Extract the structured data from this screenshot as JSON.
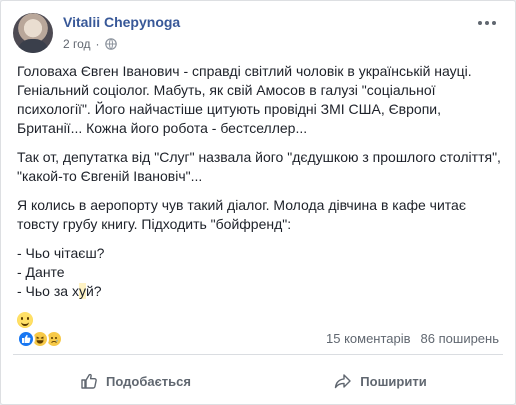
{
  "post": {
    "author": "Vitalii Chepynoga",
    "time": "2 год",
    "separator": "·",
    "paragraphs": {
      "p1": [
        "Головаха Євген Іванович - справді світлий чоловік в українській науці.",
        "Геніальний соціолог. Мабуть, як свій Амосов в галузі \"соціальної",
        "психології\". Його найчастіше цитують провідні ЗМІ США, Європи,",
        "Британії... Кожна його робота - бестселлер..."
      ],
      "p2": [
        "Так от, депутатка від \"Слуг\" назвала його \"дєдушкою з прошлого століття\",",
        "\"какой-то Євгеній Івановіч\"..."
      ],
      "p3": [
        "Я колись в аеропорту чув такий діалог. Молода дівчина в кафе читає",
        "товсту грубу книгу. Підходить \"бойфренд\":"
      ],
      "dialog": {
        "line1": "- Чьо чітаєш?",
        "line2": "- Данте",
        "line3_start": "- Чьо за х",
        "line3_hl": "у",
        "line3_end": "й?"
      }
    }
  },
  "stats": {
    "comments": "15 коментарів",
    "shares": "86 поширень",
    "reactions": [
      "like-icon",
      "haha-emoji-icon",
      "sad-emoji-icon"
    ]
  },
  "actions": {
    "like_label": "Подобається",
    "share_label": "Поширити"
  },
  "colors": {
    "author": "#385898",
    "text": "#1d2129",
    "muted": "#606770",
    "like_blue": "#1877f2",
    "emoji_yellow": "#f7c948"
  }
}
